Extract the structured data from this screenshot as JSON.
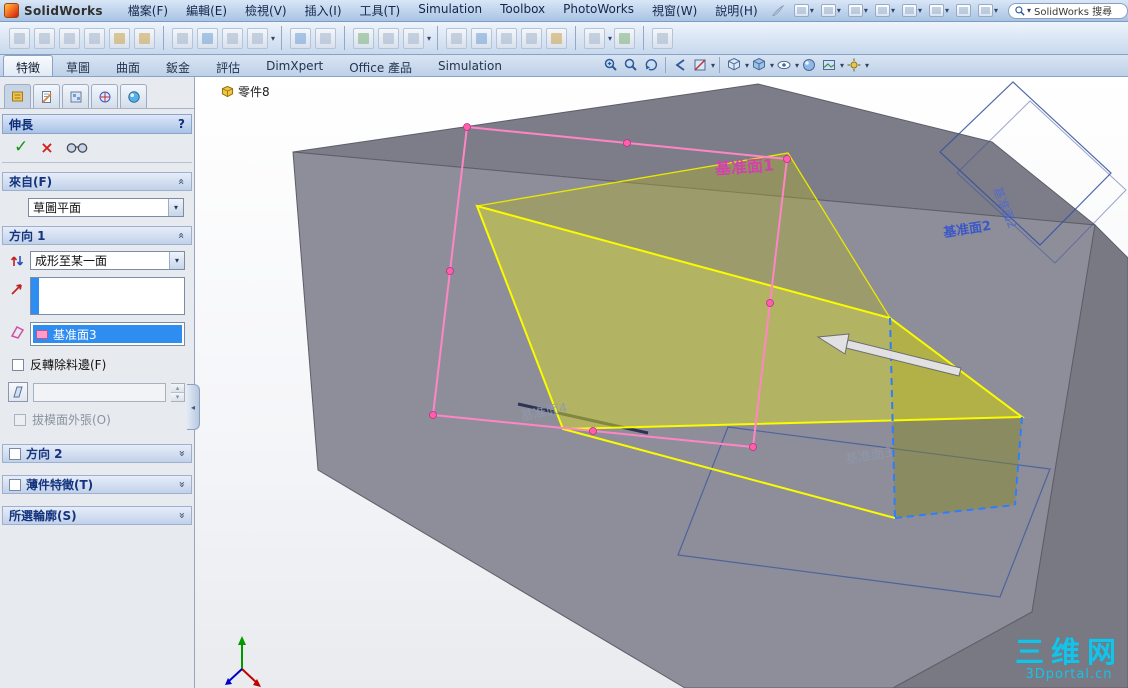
{
  "colors": {
    "titlebar_blue": "#a9c4e4",
    "selection_blue": "#2f8cf0",
    "model_gray": "#8e8e9a",
    "preview_yellow": "#fbfb00",
    "sketch_pink": "#ff85c4",
    "plane_label_pink": "#d63fae",
    "plane_label_blue": "#3c58c8",
    "watermark_cyan": "#16c3e6",
    "header_text_blue": "#14347e"
  },
  "icons": {
    "checkmark": "✓",
    "cancel": "×",
    "help": "?",
    "chevron": "«",
    "dropdown_arrow": "▾",
    "spinner_up": "▴",
    "spinner_down": "▾",
    "splitter_arrow": "◂"
  },
  "titlebar": {
    "app_name": "SolidWorks",
    "menus": [
      "檔案(F)",
      "編輯(E)",
      "檢視(V)",
      "插入(I)",
      "工具(T)",
      "Simulation",
      "Toolbox",
      "PhotoWorks",
      "視窗(W)",
      "說明(H)"
    ],
    "search_value": "SolidWorks 搜尋"
  },
  "ribbon": {
    "tabs": [
      "特徵",
      "草圖",
      "曲面",
      "鈑金",
      "評估",
      "DimXpert",
      "Office 產品",
      "Simulation"
    ],
    "active_tab": "特徵"
  },
  "feature_tree": {
    "root_label": "零件8"
  },
  "property_manager": {
    "title": "伸長",
    "from_section": {
      "label": "來自(F)",
      "value": "草圖平面"
    },
    "direction1": {
      "label": "方向 1",
      "end_condition": "成形至某一面",
      "face_reference": "基准面3",
      "flip_side_label": "反轉除料邊(F)",
      "draft_value": "",
      "draft_outward_label": "拔模面外張(O)"
    },
    "direction2_label": "方向 2",
    "thin_feature_label": "薄件特徵(T)",
    "selected_contours_label": "所選輪廓(S)"
  },
  "viewport": {
    "plane_labels": {
      "plane1": "基准面1",
      "plane2": "基准面2",
      "plane2_vertical": "基准面2",
      "plane3": "基准面3",
      "plane4": "基准面4"
    },
    "watermark": {
      "line1": "三维网",
      "line2": "3Dportal.cn"
    }
  }
}
